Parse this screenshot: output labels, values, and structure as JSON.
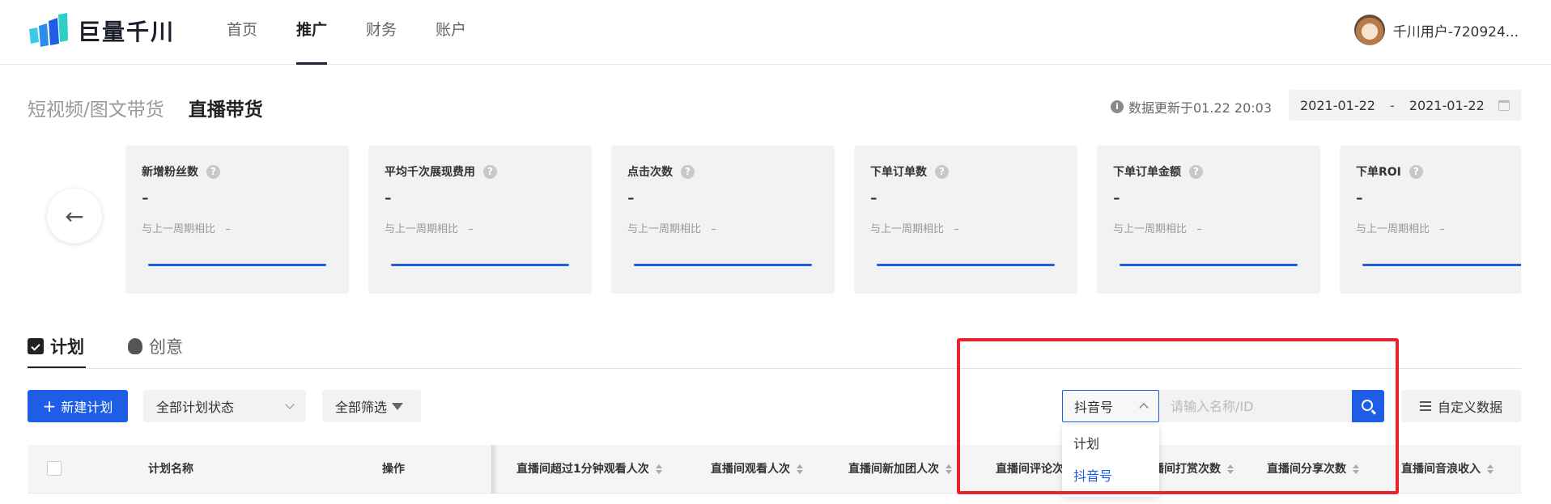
{
  "brand": {
    "name": "巨量千川"
  },
  "nav": {
    "items": [
      "首页",
      "推广",
      "财务",
      "账户"
    ],
    "active": "推广"
  },
  "user": {
    "name": "千川用户-720924..."
  },
  "subtabs": {
    "short_video": "短视频/图文带货",
    "live": "直播带货"
  },
  "update_text": "数据更新于01.22 20:03",
  "date_range": {
    "start": "2021-01-22",
    "separator": "-",
    "end": "2021-01-22"
  },
  "metrics": [
    {
      "title": "新增粉丝数",
      "value": "-",
      "compare": "与上一周期相比",
      "delta": "–"
    },
    {
      "title": "平均千次展现费用",
      "value": "-",
      "compare": "与上一周期相比",
      "delta": "–"
    },
    {
      "title": "点击次数",
      "value": "-",
      "compare": "与上一周期相比",
      "delta": "–"
    },
    {
      "title": "下单订单数",
      "value": "-",
      "compare": "与上一周期相比",
      "delta": "–"
    },
    {
      "title": "下单订单金额",
      "value": "-",
      "compare": "与上一周期相比",
      "delta": "–"
    },
    {
      "title": "下单ROI",
      "value": "-",
      "compare": "与上一周期相比",
      "delta": "–"
    }
  ],
  "tabs": {
    "plan": "计划",
    "creative": "创意"
  },
  "toolbar": {
    "new_plan": "新建计划",
    "status_select": "全部计划状态",
    "filter": "全部筛选",
    "search_type": "抖音号",
    "search_placeholder": "请输入名称/ID",
    "custom_data": "自定义数据"
  },
  "dropdown": {
    "options": [
      "计划",
      "抖音号"
    ],
    "selected": "抖音号"
  },
  "table": {
    "columns": [
      "计划名称",
      "操作",
      "直播间超过1分钟观看人次",
      "直播间观看人次",
      "直播间新加团人次",
      "直播间评论次数",
      "直播间打赏次数",
      "直播间分享次数",
      "直播间音浪收入"
    ]
  },
  "colors": {
    "primary": "#1e5ee6",
    "highlight": "#e8232b",
    "card_bg": "#f2f2f2"
  }
}
